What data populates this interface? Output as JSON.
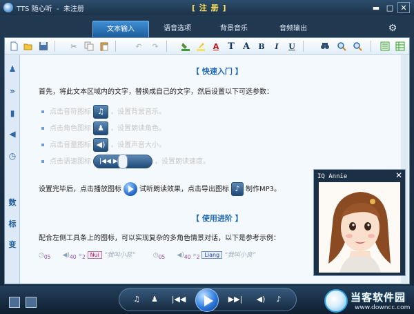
{
  "titlebar": {
    "app_title": "TTS 随心听  -  未注册",
    "register_label": "[ 注 册 ]",
    "minimize": "▬",
    "maximize": "□",
    "close": "✕"
  },
  "tabs": [
    {
      "label": "文本输入",
      "active": true
    },
    {
      "label": "语音选项",
      "active": false
    },
    {
      "label": "背景音乐",
      "active": false
    },
    {
      "label": "音频输出",
      "active": false
    }
  ],
  "toolbar_icons": [
    "new-file-icon",
    "open-folder-icon",
    "save-icon",
    "cut-icon",
    "copy-icon",
    "paste-icon",
    "undo-icon",
    "redo-icon",
    "fill-color-icon",
    "highlight-icon",
    "font-color-icon",
    "font-icon",
    "font-size-icon",
    "bold-icon",
    "italic-icon",
    "underline-icon",
    "find-icon",
    "zoom-in-icon",
    "zoom-out-icon",
    "view-list-icon",
    "view-grid-icon"
  ],
  "toolbar_letters": {
    "font_color": "A",
    "font": "T",
    "font_size": "A",
    "bold": "B",
    "italic": "I",
    "underline": "U"
  },
  "left_toolbar": {
    "icons": [
      "person-icon",
      "forward-icon",
      "equalizer-icon",
      "speaker-icon",
      "clock-icon"
    ],
    "glyphs": [
      "♟",
      "»",
      "▮",
      "◀",
      "◷"
    ],
    "vertical_text": [
      "数",
      "标",
      "变"
    ]
  },
  "content": {
    "quick_start_title": "【  快速入门  】",
    "intro": "首先，将此文本区域内的文字，替换成自己的文字，然后设置以下可选参数：",
    "bullets": [
      {
        "before": "点击音符图标",
        "icon": "♫",
        "after": "，设置背景音乐。"
      },
      {
        "before": "点击角色图标",
        "icon": "♟",
        "after": "，设置朗读角色。"
      },
      {
        "before": "点击音量图标",
        "icon": "◀)",
        "after": "，设置声音大小。"
      },
      {
        "before": "点击语速图标",
        "icon": "|◀◀ ▶▶|",
        "after": "，设置朗读速度。"
      }
    ],
    "after_setup_1": "设置完毕后，点击播放图标",
    "after_setup_2": "试听朗读效果，点击导出图标",
    "after_setup_3": "制作MP3。",
    "advanced_title": "【  使用进阶  】",
    "advanced_text": "配合左侧工具条上的图标，可以实现复杂的多角色情景对话，以下是参考示例：",
    "example": {
      "num_a": "05",
      "num_b": "40",
      "num_c": "2",
      "tag_1": "Nui",
      "quote_1": "“我叫小蕊”",
      "num_d": "05",
      "num_e": "40",
      "num_f": "2",
      "tag_2": "Liang",
      "quote_2": "“我叫小良”"
    }
  },
  "popup": {
    "title": "IQ Annie",
    "close": "✕"
  },
  "player": {
    "music_icon": "♫",
    "person_icon": "♟",
    "prev_icon": "|◀◀",
    "next_icon": "▶▶|",
    "volume_icon": "◀)",
    "export_icon": "♪"
  },
  "watermark": {
    "name": "当客软件园",
    "url": "www.downcc.com"
  }
}
